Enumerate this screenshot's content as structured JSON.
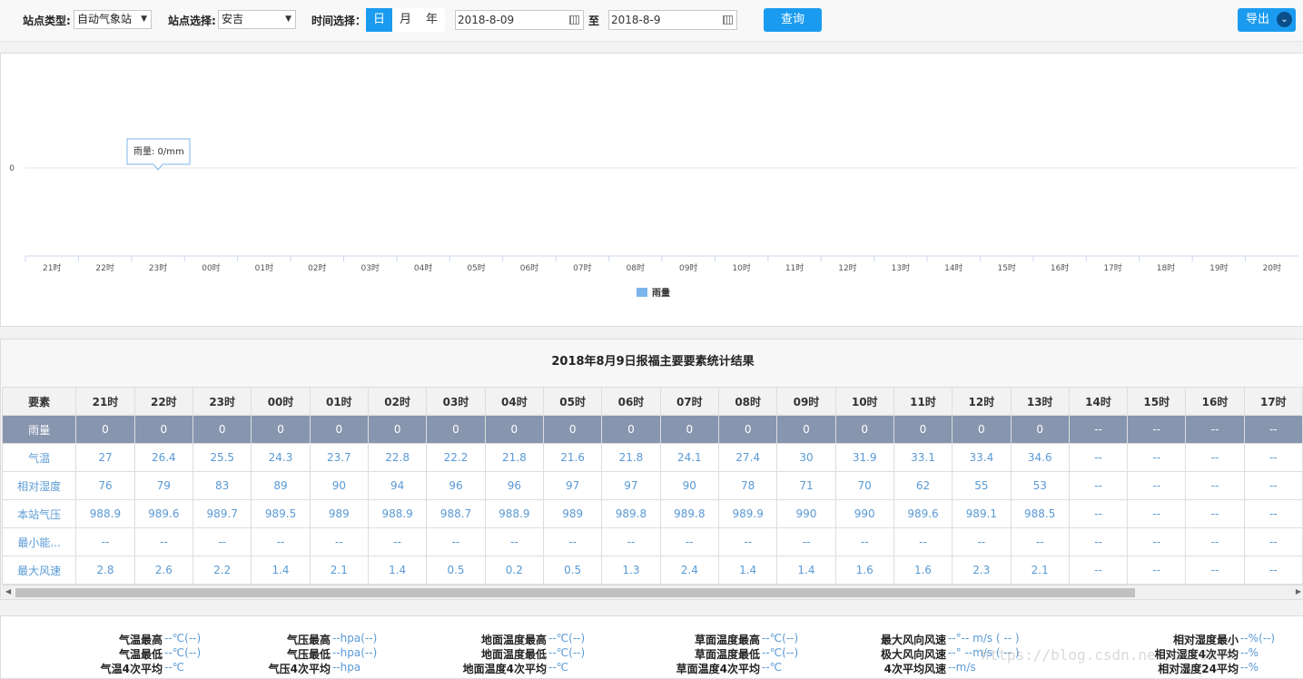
{
  "toolbar": {
    "station_type_label": "站点类型:",
    "station_type_value": "自动气象站",
    "station_label": "站点选择:",
    "station_value": "安吉",
    "time_label": "时间选择：",
    "tabs": [
      "日",
      "月",
      "年"
    ],
    "active_tab": "日",
    "date_from": "2018-8-09",
    "date_sep": "至",
    "date_to": "2018-8-9",
    "query_label": "查询",
    "export_label": "导出"
  },
  "chart_data": {
    "type": "bar",
    "categories": [
      "21时",
      "22时",
      "23时",
      "00时",
      "01时",
      "02时",
      "03时",
      "04时",
      "05时",
      "06时",
      "07时",
      "08时",
      "09时",
      "10时",
      "11时",
      "12时",
      "13时",
      "14时",
      "15时",
      "16时",
      "17时",
      "18时",
      "19时",
      "20时"
    ],
    "series": [
      {
        "name": "雨量",
        "values": [
          0,
          0,
          0,
          0,
          0,
          0,
          0,
          0,
          0,
          0,
          0,
          0,
          0,
          0,
          0,
          0,
          0,
          null,
          null,
          null,
          null,
          null,
          null,
          null
        ]
      }
    ],
    "yticks": [
      "0"
    ],
    "tooltip": "雨量: 0/mm",
    "legend": "雨量",
    "legend_color": "#7cb5ec"
  },
  "table": {
    "title": "2018年8月9日报福主要要素统计结果",
    "header_first": "要素",
    "columns": [
      "21时",
      "22时",
      "23时",
      "00时",
      "01时",
      "02时",
      "03时",
      "04时",
      "05时",
      "06时",
      "07时",
      "08时",
      "09时",
      "10时",
      "11时",
      "12时",
      "13时",
      "14时",
      "15时",
      "16时",
      "17时"
    ],
    "rows": [
      {
        "label": "雨量",
        "values": [
          "0",
          "0",
          "0",
          "0",
          "0",
          "0",
          "0",
          "0",
          "0",
          "0",
          "0",
          "0",
          "0",
          "0",
          "0",
          "0",
          "0",
          "--",
          "--",
          "--",
          "--"
        ]
      },
      {
        "label": "气温",
        "values": [
          "27",
          "26.4",
          "25.5",
          "24.3",
          "23.7",
          "22.8",
          "22.2",
          "21.8",
          "21.6",
          "21.8",
          "24.1",
          "27.4",
          "30",
          "31.9",
          "33.1",
          "33.4",
          "34.6",
          "--",
          "--",
          "--",
          "--"
        ]
      },
      {
        "label": "相对湿度",
        "values": [
          "76",
          "79",
          "83",
          "89",
          "90",
          "94",
          "96",
          "96",
          "97",
          "97",
          "90",
          "78",
          "71",
          "70",
          "62",
          "55",
          "53",
          "--",
          "--",
          "--",
          "--"
        ]
      },
      {
        "label": "本站气压",
        "values": [
          "988.9",
          "989.6",
          "989.7",
          "989.5",
          "989",
          "988.9",
          "988.7",
          "988.9",
          "989",
          "989.8",
          "989.8",
          "989.9",
          "990",
          "990",
          "989.6",
          "989.1",
          "988.5",
          "--",
          "--",
          "--",
          "--"
        ]
      },
      {
        "label": "最小能...",
        "values": [
          "--",
          "--",
          "--",
          "--",
          "--",
          "--",
          "--",
          "--",
          "--",
          "--",
          "--",
          "--",
          "--",
          "--",
          "--",
          "--",
          "--",
          "--",
          "--",
          "--",
          "--"
        ]
      },
      {
        "label": "最大风速",
        "values": [
          "2.8",
          "2.6",
          "2.2",
          "1.4",
          "2.1",
          "1.4",
          "0.5",
          "0.2",
          "0.5",
          "1.3",
          "2.4",
          "1.4",
          "1.4",
          "1.6",
          "1.6",
          "2.3",
          "2.1",
          "--",
          "--",
          "--",
          "--"
        ]
      }
    ]
  },
  "stats": [
    {
      "label": "气温最高",
      "value": "--℃(--)"
    },
    {
      "label": "气温最低",
      "value": "--℃(--)"
    },
    {
      "label": "气温4次平均",
      "value": "--℃"
    },
    {
      "label": "气压最高",
      "value": "--hpa(--)"
    },
    {
      "label": "气压最低",
      "value": "--hpa(--)"
    },
    {
      "label": "气压4次平均",
      "value": "--hpa"
    },
    {
      "label": "地面温度最高",
      "value": "--℃(--)"
    },
    {
      "label": "地面温度最低",
      "value": "--℃(--)"
    },
    {
      "label": "地面温度4次平均",
      "value": "--℃"
    },
    {
      "label": "草面温度最高",
      "value": "--℃(--)"
    },
    {
      "label": "草面温度最低",
      "value": "--℃(--)"
    },
    {
      "label": "草面温度4次平均",
      "value": "--℃"
    },
    {
      "label": "最大风向风速",
      "value": "--°-- m/s ( -- )"
    },
    {
      "label": "极大风向风速",
      "value": "--° --m/s ( -- )"
    },
    {
      "label": "4次平均风速",
      "value": "--m/s"
    },
    {
      "label": "相对湿度最小",
      "value": "--%(--)"
    },
    {
      "label": "相对湿度4次平均",
      "value": "--%"
    },
    {
      "label": "相对湿度24平均",
      "value": "--%"
    }
  ],
  "watermark": "https://blog.csdn.net/u010806"
}
